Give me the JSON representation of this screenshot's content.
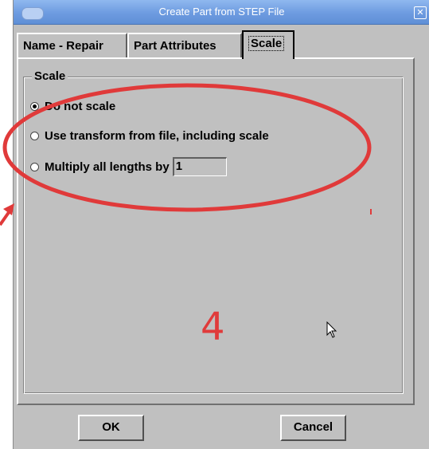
{
  "window": {
    "title": "Create Part from STEP File"
  },
  "tabs": [
    {
      "label": "Name - Repair",
      "active": false
    },
    {
      "label": "Part Attributes",
      "active": false
    },
    {
      "label": "Scale",
      "active": true
    }
  ],
  "scale_group": {
    "title": "Scale",
    "options": [
      {
        "label": "Do not scale",
        "selected": true
      },
      {
        "label": "Use transform from file, including scale",
        "selected": false
      },
      {
        "label": "Multiply all lengths by",
        "selected": false
      }
    ],
    "multiplier_value": "1"
  },
  "buttons": {
    "ok": "OK",
    "cancel": "Cancel"
  },
  "annotation": {
    "number": "4",
    "color": "#e03a3a"
  },
  "colors": {
    "title_bar": "#6d9be0",
    "dialog_bg": "#c0c0c0"
  }
}
